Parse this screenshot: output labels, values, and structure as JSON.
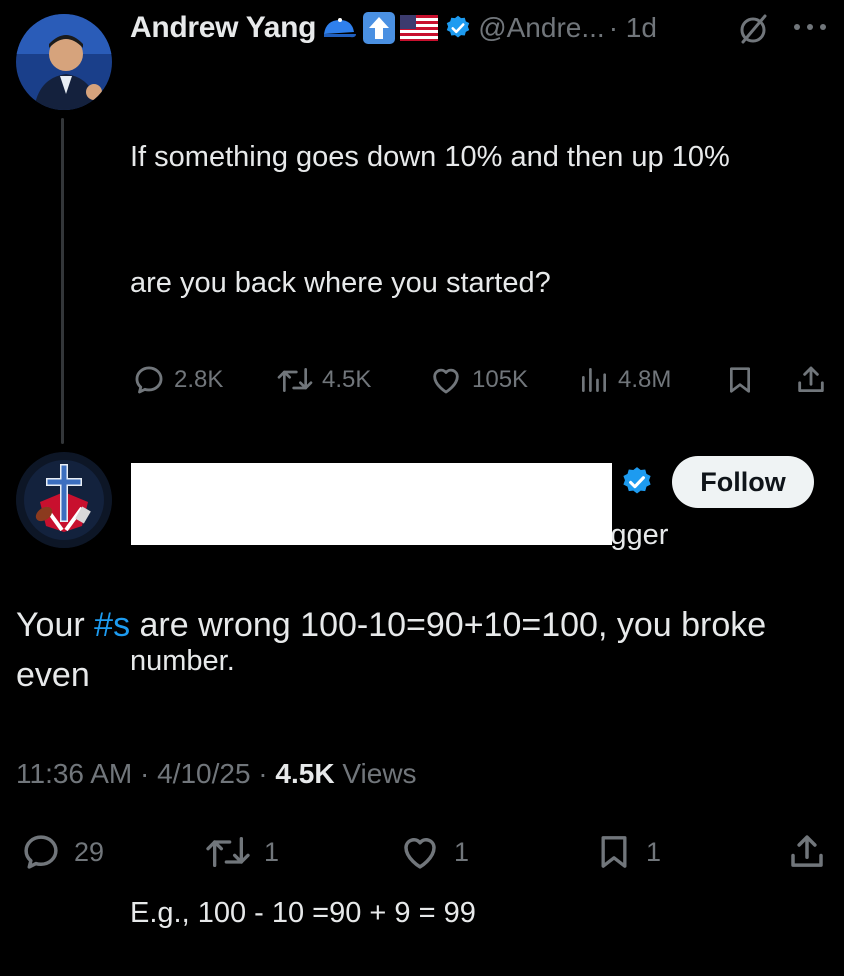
{
  "parent": {
    "name": "Andrew Yang",
    "handle": "@Andre...",
    "time": "· 1d",
    "text_lines": [
      "If something goes down 10% and then up 10%",
      "are you back where you started?",
      "",
      "No because the decrease is from a bigger",
      "number.",
      "",
      "E.g., 100 - 10 =90 + 9 = 99"
    ],
    "stats": {
      "replies": "2.8K",
      "reposts": "4.5K",
      "likes": "105K",
      "views": "4.8M"
    }
  },
  "reply": {
    "follow_label": "Follow",
    "text_before": "Your ",
    "hashtag": "#s",
    "text_after": " are wrong 100-10=90+10=100, you broke even",
    "meta_time": "11:36 AM · 4/10/25 · ",
    "meta_views_count": "4.5K",
    "meta_views_label": " Views",
    "stats": {
      "replies": "29",
      "reposts": "1",
      "likes": "1",
      "bookmarks": "1"
    }
  },
  "colors": {
    "background": "#000000",
    "text": "#e7e9ea",
    "muted": "#71767b",
    "accent": "#1d9bf0"
  },
  "icons": [
    "cap-emoji-icon",
    "up-arrow-emoji-icon",
    "us-flag-emoji-icon",
    "verified-badge-icon",
    "mute-icon",
    "more-icon",
    "reply-icon",
    "repost-icon",
    "like-icon",
    "views-icon",
    "bookmark-icon",
    "share-icon"
  ]
}
